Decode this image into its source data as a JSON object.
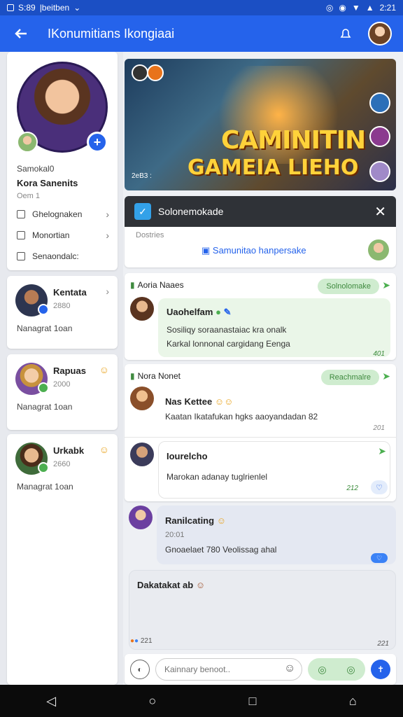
{
  "status_bar": {
    "time": "S:89",
    "carrier": "|beitben",
    "right_time": "2:21"
  },
  "app_bar": {
    "title": "IKonumitians Ikongiaai"
  },
  "sidebar": {
    "profile": {
      "label": "Samokal0",
      "name": "Kora Sanenits",
      "sub": "Oem 1"
    },
    "menu": [
      {
        "label": "Ghelognaken"
      },
      {
        "label": "Monortian"
      },
      {
        "label": "Senaondalc:"
      }
    ],
    "contacts": [
      {
        "name": "Kentata",
        "count": "2880",
        "sub": "Nanagrat 1oan"
      },
      {
        "name": "Rapuas",
        "count": "2000",
        "sub": "Nanagrat 1oan"
      },
      {
        "name": "Urkabk",
        "count": "2660",
        "sub": "Managrat 1oan"
      }
    ]
  },
  "banner": {
    "line1": "CAMINITIN",
    "line2": "GAMEIA LIEHO",
    "small": "2eB3 :"
  },
  "notification": {
    "title": "Solonemokade",
    "details_label": "Dostries",
    "link": "Samunitao hanpersake"
  },
  "posts": [
    {
      "header": "Aoria Naaes",
      "pill": "Solnolomake",
      "message_title": "Uaohelfam",
      "lines": [
        "Sosiliqy soraanastaiac kra onalk",
        "Karkal lonnonal cargidang Eenga"
      ],
      "stamp": "401"
    },
    {
      "header": "Nora Nonet",
      "pill": "Reachmalre",
      "message_title": "Nas  Kettee",
      "lines": [
        "Kaatan Ikatafukan hgks aaoyandadan 82"
      ],
      "stamp": "201"
    }
  ],
  "reply": {
    "title": "Iourelcho",
    "line": "Marokan adanay tuglrienlel",
    "stamp": "212"
  },
  "thread": {
    "title": "Ranilcating",
    "count": "20:01",
    "line": "Gnoaelaet 780  Veolissag ahal"
  },
  "draft": {
    "title": "Dakatakat ab",
    "stamp": "221",
    "stamp2": "221"
  },
  "composer": {
    "placeholder": "Kainnary benoot.."
  }
}
